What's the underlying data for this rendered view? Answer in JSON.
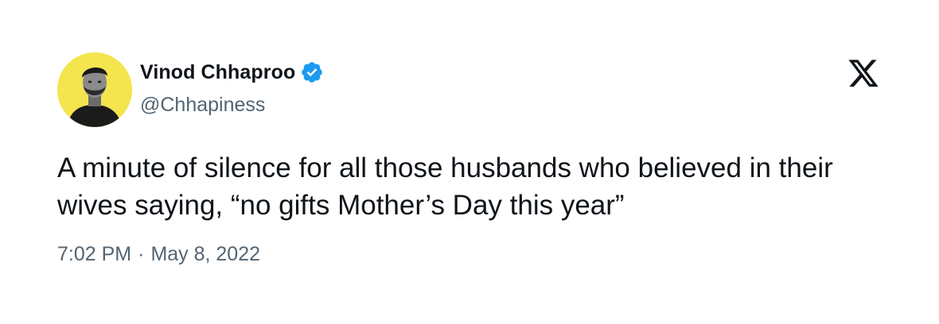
{
  "author": {
    "display_name": "Vinod Chhaproo",
    "handle": "@Chhapiness",
    "verified": true,
    "avatar_background": "#f4e54f"
  },
  "tweet": {
    "text": "A minute of silence for all those husbands who believed in their wives saying, “no gifts Mother’s Day this year”",
    "time": "7:02 PM",
    "separator": "·",
    "date": "May 8, 2022"
  },
  "icons": {
    "verified": "verified-badge-icon",
    "platform_logo": "x-logo-icon"
  },
  "colors": {
    "text_primary": "#0f1419",
    "text_secondary": "#536471",
    "verified_blue": "#1d9bf0",
    "background": "#ffffff"
  }
}
